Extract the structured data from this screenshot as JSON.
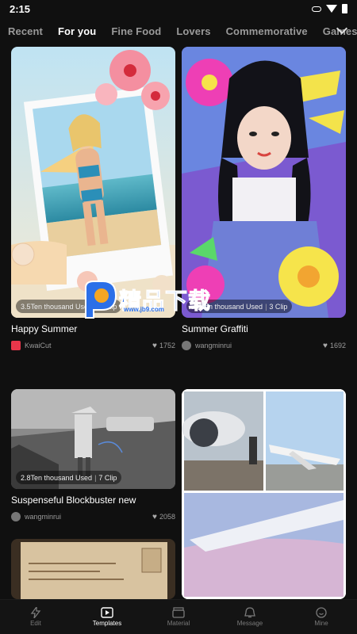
{
  "status": {
    "time": "2:15"
  },
  "tabs": [
    "Recent",
    "For you",
    "Fine Food",
    "Lovers",
    "Commemorative",
    "Games"
  ],
  "cards": [
    {
      "title": "Happy Summer",
      "uses": "3.5Ten thousand Used",
      "clips": "5 Clip",
      "author": "KwaiCut",
      "likes": "1752"
    },
    {
      "title": "Summer Graffiti",
      "uses": "2.9Ten thousand Used",
      "clips": "3 Clip",
      "author": "wangminrui",
      "likes": "1692"
    },
    {
      "title": "Suspenseful Blockbuster new",
      "uses": "2.8Ten thousand Used",
      "clips": "7 Clip",
      "author": "wangminrui",
      "likes": "2058"
    }
  ],
  "watermark": {
    "brand": "精品下载",
    "url": "www.jb9.com"
  },
  "nav": [
    {
      "label": "Edit",
      "icon": "lightning-icon"
    },
    {
      "label": "Templates",
      "icon": "play-box-icon"
    },
    {
      "label": "Material",
      "icon": "clapper-icon"
    },
    {
      "label": "Message",
      "icon": "bell-icon"
    },
    {
      "label": "Mine",
      "icon": "smiley-icon"
    }
  ],
  "colors": {
    "background": "#101010",
    "active_tab": "#ffffff",
    "inactive_tab": "#9a9a9a",
    "watermark": "#2b6fe8"
  }
}
